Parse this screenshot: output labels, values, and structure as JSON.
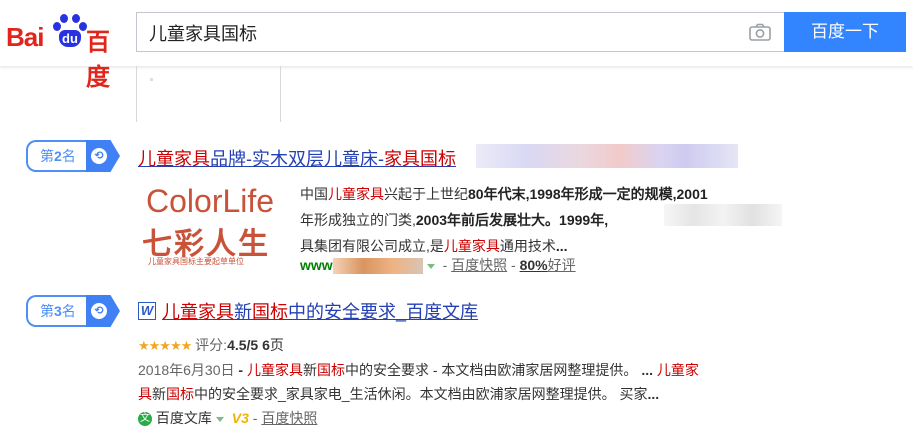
{
  "header": {
    "logo": {
      "bai": "Bai",
      "du": "du",
      "cn": "百度"
    },
    "search_value": "儿童家具国标",
    "search_button": "百度一下",
    "camera_icon": "camera-icon"
  },
  "results": [
    {
      "rank": {
        "prefix": "第",
        "num": "2",
        "suffix": "名"
      },
      "title": {
        "p1": "儿童家具",
        "p2": "品牌-实木双层儿童床-",
        "p3": "家具国标"
      },
      "thumb": {
        "line1": "ColorLife",
        "line2": "七彩人生",
        "line3": "儿童家具国标主要起草单位"
      },
      "abstract": {
        "s1": "中国",
        "s2": "儿童家具",
        "s3": "兴起于上世纪",
        "s4": "80",
        "s5": "年代末,",
        "s6": "1998",
        "s7": "年形成一定的规模,",
        "s8": "2001",
        "s9": "年形成独立的门类,",
        "s10": "2003",
        "s11": "年前后发展壮大。",
        "s12": "1999",
        "s13": "年,",
        "s14": "具集团有限公司成立,是",
        "s15": "儿童家具",
        "s16": "通用技术",
        "s17": "..."
      },
      "meta": {
        "url_prefix": "www",
        "snapshot": "百度快照",
        "sep": "-",
        "good_pct": "80%",
        "good": "好评"
      }
    },
    {
      "rank": {
        "prefix": "第",
        "num": "3",
        "suffix": "名"
      },
      "title": {
        "p1": "儿童家具",
        "p2": "新",
        "p3": "国标",
        "p4": "中的安全要求_百度文库"
      },
      "rating": {
        "stars": "★★★★★",
        "label": "评分:",
        "score": "4.5/5",
        "pages": "6",
        "pages_label": "页"
      },
      "abstract": {
        "date": "2018年6月30日",
        "sep": " - ",
        "a1": "儿童家具",
        "a2": "新",
        "a3": "国标",
        "a4": "中的安全要求",
        "a5": " - 本文档由欧浦家居网整理提供。",
        "a6": "...",
        "a7": "儿童家",
        "a8": "具",
        "a9": "新",
        "a10": "国标",
        "a11": "中的安全要求_家具家电_生活休闲。本文档由欧浦家居网整理提供。 买家",
        "a12": "..."
      },
      "meta": {
        "source": "百度文库",
        "v3": "V3",
        "snapshot": "百度快照",
        "sep": "-"
      }
    }
  ]
}
